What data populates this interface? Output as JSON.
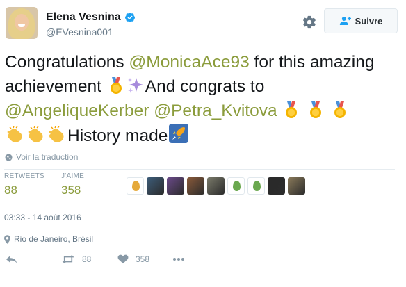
{
  "profile": {
    "display_name": "Elena Vesnina",
    "handle": "@EVesnina001",
    "verified": true
  },
  "follow_button": {
    "label": "Suivre"
  },
  "tweet": {
    "segments": {
      "s1": "Congratulations ",
      "m1": "@MonicaAce93",
      "s2": " for this amazing achievement ",
      "s3": "And congrats to ",
      "m2": "@AngeliqueKerber",
      "s4": " ",
      "m3": "@Petra_Kvitova",
      "s5": "History made"
    },
    "emojis": [
      "medal-icon",
      "sparkles-icon",
      "medal-icon",
      "medal-icon",
      "medal-icon",
      "clapping-hands-icon",
      "clapping-hands-icon",
      "clapping-hands-icon",
      "rocket-icon"
    ]
  },
  "translate": {
    "label": "Voir la traduction"
  },
  "stats": {
    "retweets_label": "RETWEETS",
    "retweets_value": "88",
    "likes_label": "J'AIME",
    "likes_value": "358"
  },
  "likers": [
    {
      "type": "egg",
      "color": "#e5a93a"
    },
    {
      "type": "photo",
      "color": "#3d5d7a"
    },
    {
      "type": "photo",
      "color": "#6b4a8a"
    },
    {
      "type": "photo",
      "color": "#8a5a3a"
    },
    {
      "type": "photo",
      "color": "#7a7a6a"
    },
    {
      "type": "egg",
      "color": "#6aa84f"
    },
    {
      "type": "egg",
      "color": "#6aa84f"
    },
    {
      "type": "photo",
      "color": "#2a2a2a"
    },
    {
      "type": "photo",
      "color": "#8a7a5a"
    }
  ],
  "timestamp": "03:33 - 14 août 2016",
  "location": "Rio de Janeiro, Brésil",
  "actions": {
    "retweet_count": "88",
    "like_count": "358"
  },
  "colors": {
    "accent": "#8b9c3c",
    "muted": "#8899a6",
    "verified": "#1da1f2"
  }
}
